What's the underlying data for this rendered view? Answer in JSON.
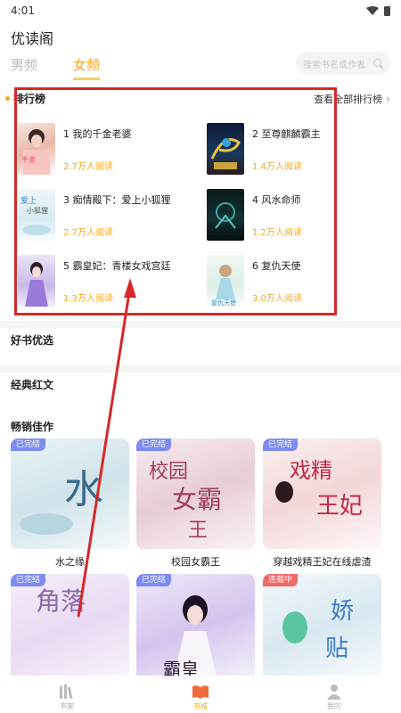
{
  "status_bar": {
    "time": "4:01"
  },
  "app": {
    "title": "优读阁"
  },
  "tabs": [
    {
      "label": "男频",
      "active": false
    },
    {
      "label": "女频",
      "active": true
    }
  ],
  "search": {
    "placeholder": "搜索书名或作者"
  },
  "ranking": {
    "title": "排行榜",
    "view_all": "查看全部排行榜",
    "items": [
      {
        "name": "1 我的千金老婆",
        "reads": "2.7万人阅读"
      },
      {
        "name": "2 至尊麒麟霸主",
        "reads": "1.4万人阅读"
      },
      {
        "name": "3 痴情殿下：爱上小狐狸",
        "reads": "2.7万人阅读"
      },
      {
        "name": "4 风水命师",
        "reads": "1.2万人阅读"
      },
      {
        "name": "5 霸皇妃：青楼女戏宫廷",
        "reads": "1.3万人阅读"
      },
      {
        "name": "6 复仇天使",
        "reads": "3.0万人阅读"
      }
    ]
  },
  "sections": {
    "good_books": "好书优选",
    "classic": "经典红文",
    "bestsellers": "畅销佳作"
  },
  "bestsellers": [
    {
      "title": "水之缘",
      "badge": "已完结"
    },
    {
      "title": "校园女霸王",
      "badge": "已完结"
    },
    {
      "title": "穿越戏精王妃在线虐渣",
      "badge": "已完结"
    },
    {
      "title": "",
      "badge": "已完结"
    },
    {
      "title": "",
      "badge": "已完结"
    },
    {
      "title": "",
      "badge": "连载中"
    }
  ],
  "bottom_nav": [
    {
      "label": "书架",
      "icon": "bookshelf-icon",
      "active": false
    },
    {
      "label": "书城",
      "icon": "bookstore-icon",
      "active": true
    },
    {
      "label": "我的",
      "icon": "profile-icon",
      "active": false
    }
  ],
  "colors": {
    "accent": "#f5a623",
    "badge_done": "#7c8cf0",
    "badge_serial": "#f06a6a",
    "highlight": "#d62828"
  }
}
